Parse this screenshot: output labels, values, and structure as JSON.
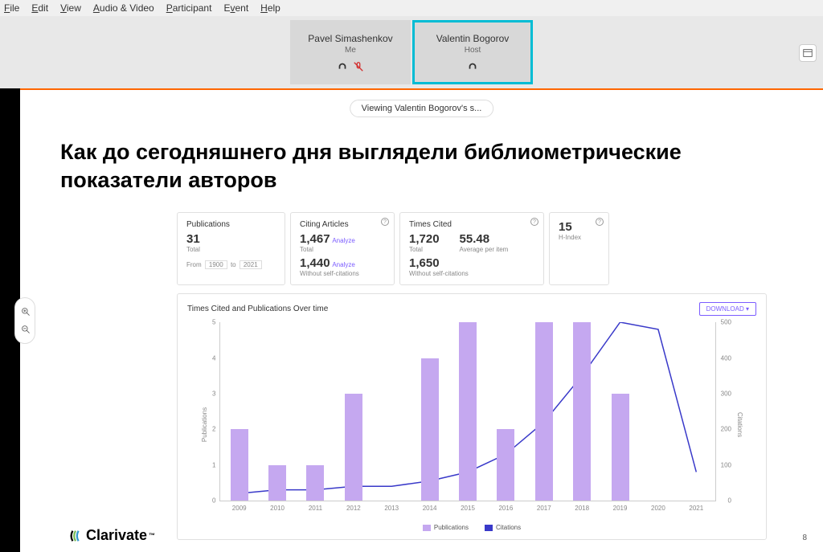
{
  "menubar": [
    "File",
    "Edit",
    "View",
    "Audio & Video",
    "Participant",
    "Event",
    "Help"
  ],
  "participants": [
    {
      "name": "Pavel Simashenkov",
      "role": "Me",
      "muted": true
    },
    {
      "name": "Valentin Bogorov",
      "role": "Host",
      "active": true
    }
  ],
  "viewing_label": "Viewing Valentin Bogorov's s...",
  "slide": {
    "title": "Как до сегодняшнего дня выглядели библиометрические показатели авторов",
    "cards": {
      "publications": {
        "title": "Publications",
        "value": "31",
        "sub": "Total",
        "from": "From",
        "year1": "1900",
        "to": "to",
        "year2": "2021"
      },
      "citing": {
        "title": "Citing Articles",
        "v1": "1,467",
        "a": "Analyze",
        "s1": "Total",
        "v2": "1,440",
        "s2": "Without self-citations"
      },
      "times": {
        "title": "Times Cited",
        "v1": "1,720",
        "s1": "Total",
        "avg": "55.48",
        "avgl": "Average per item",
        "v2": "1,650",
        "s2": "Without self-citations"
      },
      "hindex": {
        "value": "15",
        "label": "H-Index"
      }
    },
    "chart_title": "Times Cited and Publications Over time",
    "download": "DOWNLOAD",
    "ylabel_left": "Publications",
    "ylabel_right": "Citations",
    "legend": {
      "pub": "Publications",
      "cit": "Citations"
    },
    "brand": "Clarivate",
    "page": "8"
  },
  "chart_data": {
    "type": "bar_line_combo",
    "title": "Times Cited and Publications Over time",
    "x_categories": [
      "2009",
      "2010",
      "2011",
      "2012",
      "2013",
      "2014",
      "2015",
      "2016",
      "2017",
      "2018",
      "2019",
      "2020",
      "2021"
    ],
    "series": [
      {
        "name": "Publications",
        "type": "bar",
        "axis": "left",
        "values": [
          2,
          1,
          1,
          3,
          0,
          4,
          5,
          2,
          5,
          5,
          3,
          0,
          0
        ]
      },
      {
        "name": "Citations",
        "type": "line",
        "axis": "right",
        "values": [
          20,
          30,
          30,
          40,
          40,
          55,
          80,
          130,
          220,
          350,
          500,
          480,
          80
        ]
      }
    ],
    "y_left": {
      "label": "Publications",
      "ticks": [
        0,
        1,
        2,
        3,
        4,
        5
      ],
      "range": [
        0,
        5
      ]
    },
    "y_right": {
      "label": "Citations",
      "ticks": [
        0,
        100,
        200,
        300,
        400,
        500
      ],
      "range": [
        0,
        500
      ]
    }
  }
}
